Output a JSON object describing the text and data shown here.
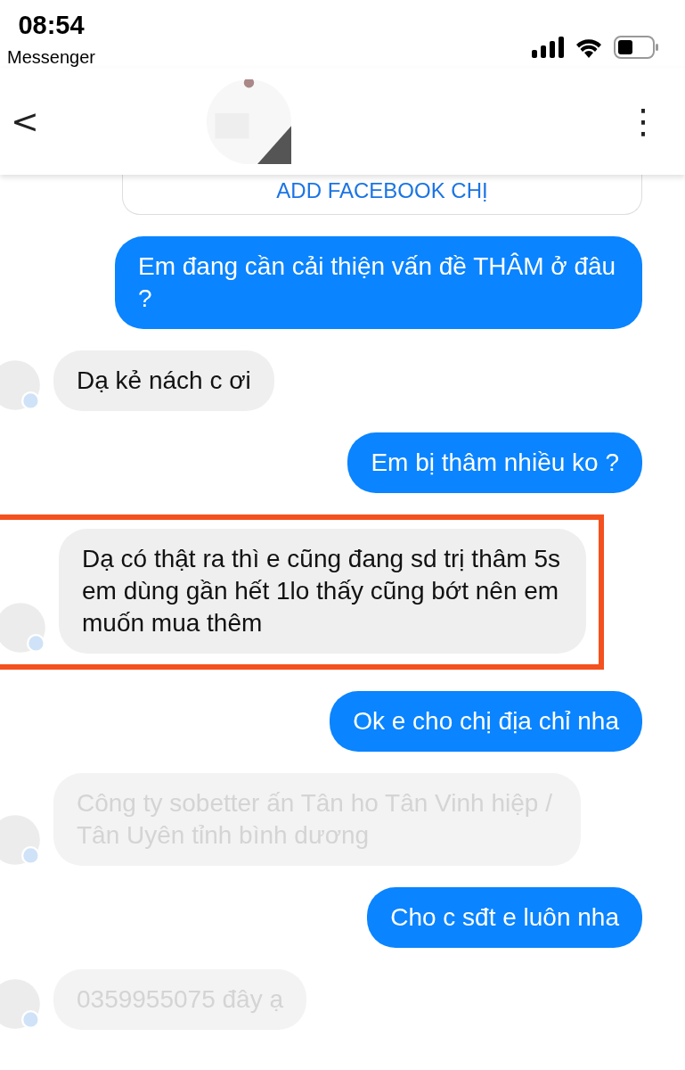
{
  "status_bar": {
    "time": "08:54",
    "back_app": "Messenger"
  },
  "header": {
    "back": "<",
    "menu": "⋮"
  },
  "messages": [
    {
      "kind": "card",
      "text": "ADD FACEBOOK CHỊ"
    },
    {
      "kind": "outgoing",
      "text": "Em đang cần cải thiện vấn đề THÂM ở đâu ?"
    },
    {
      "kind": "incoming",
      "text": "Dạ kẻ nách c ơi",
      "faded": false,
      "highlighted": false
    },
    {
      "kind": "outgoing",
      "text": "Em bị thâm nhiều ko ?"
    },
    {
      "kind": "incoming",
      "text": "Dạ có thật ra thì e cũng đang sd trị thâm 5s em dùng gần hết 1lo thấy cũng bớt nên em muốn mua thêm",
      "faded": false,
      "highlighted": true
    },
    {
      "kind": "outgoing",
      "text": "Ok e cho chị địa chỉ nha"
    },
    {
      "kind": "incoming",
      "text": "Công ty sobetter ấn Tân ho Tân Vinh hiệp / Tân Uyên tỉnh bình dương",
      "faded": true,
      "highlighted": false
    },
    {
      "kind": "outgoing",
      "text": "Cho c sđt e luôn nha"
    },
    {
      "kind": "incoming",
      "text": "0359955075 đây ạ",
      "faded": true,
      "highlighted": false
    }
  ]
}
